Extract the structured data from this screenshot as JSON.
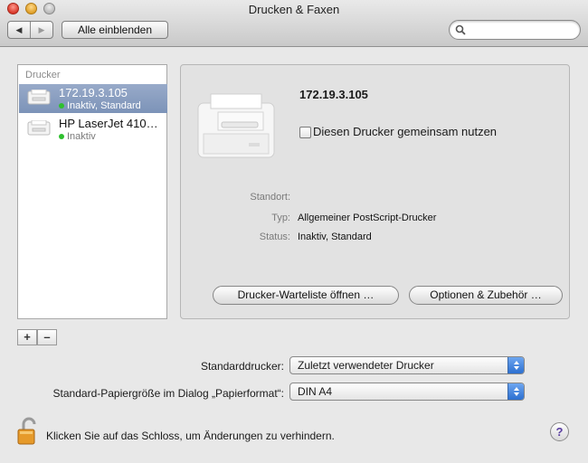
{
  "window": {
    "title": "Drucken & Faxen"
  },
  "toolbar": {
    "back_glyph": "◀",
    "forward_glyph": "▶",
    "show_all_label": "Alle einblenden",
    "search_value": "",
    "search_icon": "search-icon"
  },
  "printer_list": {
    "header": "Drucker",
    "items": [
      {
        "name": "172.19.3.105",
        "status": "Inaktiv, Standard",
        "status_color": "#2ec02e",
        "selected": true
      },
      {
        "name": "HP LaserJet 410…",
        "status": "Inaktiv",
        "status_color": "#2ec02e",
        "selected": false
      }
    ],
    "add_label": "+",
    "remove_label": "–"
  },
  "detail": {
    "printer_name": "172.19.3.105",
    "share_checkbox_label": "Diesen Drucker gemeinsam nutzen",
    "share_checked": false,
    "fields": [
      {
        "key": "Standort:",
        "value": ""
      },
      {
        "key": "Typ:",
        "value": "Allgemeiner PostScript-Drucker"
      },
      {
        "key": "Status:",
        "value": "Inaktiv, Standard"
      }
    ],
    "queue_button": "Drucker-Warteliste öffnen …",
    "options_button": "Optionen & Zubehör …"
  },
  "defaults": {
    "default_printer_label": "Standarddrucker:",
    "default_printer_value": "Zuletzt verwendeter Drucker",
    "paper_size_label": "Standard-Papiergröße im Dialog „Papierformat“:",
    "paper_size_value": "DIN A4"
  },
  "footer": {
    "lock_text": "Klicken Sie auf das Schloss, um Änderungen zu verhindern.",
    "help_label": "?"
  },
  "colors": {
    "selection": "#7c93b8",
    "popup_arrow": "#2c6fd0"
  }
}
